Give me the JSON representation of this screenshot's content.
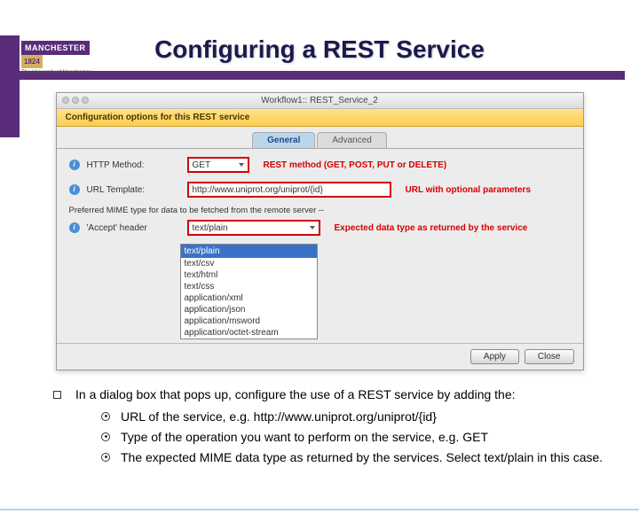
{
  "logo": {
    "name": "MANCHESTER",
    "year": "1824",
    "sub": "The University of Manchester"
  },
  "title": "Configuring a REST Service",
  "dialog": {
    "window_title": "Workflow1:: REST_Service_2",
    "banner": "Configuration options for this REST service",
    "tabs": {
      "general": "General",
      "advanced": "Advanced"
    },
    "rows": {
      "http_method": {
        "label": "HTTP Method:",
        "value": "GET",
        "annotation": "REST method (GET, POST, PUT or DELETE)"
      },
      "url_template": {
        "label": "URL Template:",
        "value": "http://www.uniprot.org/uniprot/{id}",
        "annotation": "URL with optional parameters"
      },
      "mime_note": "Preferred MIME type for data to be fetched from the remote server --",
      "accept": {
        "label": "'Accept' header",
        "value": "text/plain",
        "annotation": "Expected data type as returned by the service"
      }
    },
    "dropdown_options": [
      "text/plain",
      "text/csv",
      "text/html",
      "text/css",
      "application/xml",
      "application/json",
      "application/msword",
      "application/octet-stream"
    ],
    "buttons": {
      "apply": "Apply",
      "close": "Close"
    }
  },
  "body": {
    "intro": "In a dialog box that pops up, configure the use of a  REST service by adding the:",
    "points": [
      "URL of the service, e.g. http://www.uniprot.org/uniprot/{id}",
      "Type of the operation you want to perform on the service, e.g. GET",
      "The expected MIME data type as returned by the services. Select text/plain in this case."
    ]
  }
}
